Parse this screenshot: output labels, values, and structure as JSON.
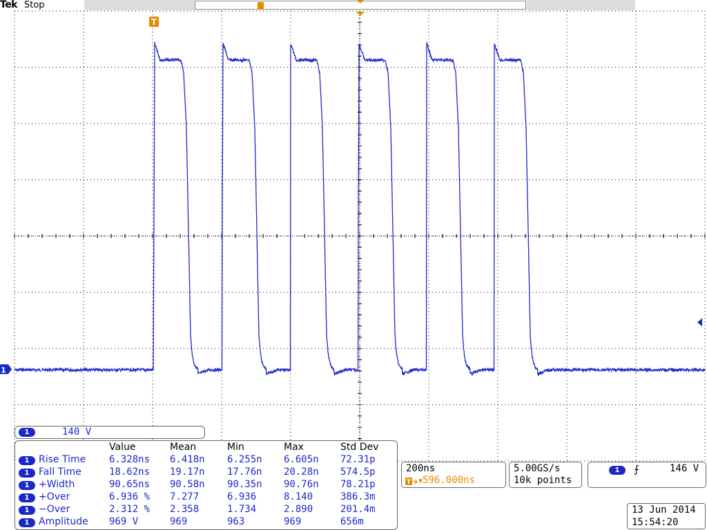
{
  "header": {
    "brand": "Tek",
    "run_state": "Stop"
  },
  "colors": {
    "trace": "#1c28c8",
    "trigger": "#e68a00",
    "graticule": "#000000",
    "background": "#ffffff"
  },
  "channel": {
    "number": "1",
    "scale": "140 V"
  },
  "measurements": {
    "columns": [
      "Value",
      "Mean",
      "Min",
      "Max",
      "Std Dev"
    ],
    "rows": [
      {
        "name": "Rise Time",
        "value": "6.328ns",
        "mean": "6.418n",
        "min": "6.255n",
        "max": "6.605n",
        "std": "72.31p"
      },
      {
        "name": "Fall Time",
        "value": "18.62ns",
        "mean": "19.17n",
        "min": "17.76n",
        "max": "20.28n",
        "std": "574.5p"
      },
      {
        "name": "+Width",
        "value": "90.65ns",
        "mean": "90.58n",
        "min": "90.35n",
        "max": "90.76n",
        "std": "78.21p"
      },
      {
        "name": "+Over",
        "value": "6.936 %",
        "mean": "7.277",
        "min": "6.936",
        "max": "8.140",
        "std": "386.3m"
      },
      {
        "name": "−Over",
        "value": "2.312 %",
        "mean": "2.358",
        "min": "1.734",
        "max": "2.890",
        "std": "201.4m"
      },
      {
        "name": "Amplitude",
        "value": "969 V",
        "mean": "969",
        "min": "963",
        "max": "969",
        "std": "656m"
      }
    ]
  },
  "horizontal": {
    "scale": "200ns",
    "position": "596.000ns"
  },
  "acquisition": {
    "sample_rate": "5.00GS/s",
    "record_length": "10k points"
  },
  "trigger": {
    "source": "1",
    "slope_icon": "rising-edge-icon",
    "slope_glyph": "⨍",
    "level": "146 V",
    "marker": "T"
  },
  "datetime": {
    "date": "13 Jun  2014",
    "time": "15:54:20"
  },
  "ground_marker": "1"
}
